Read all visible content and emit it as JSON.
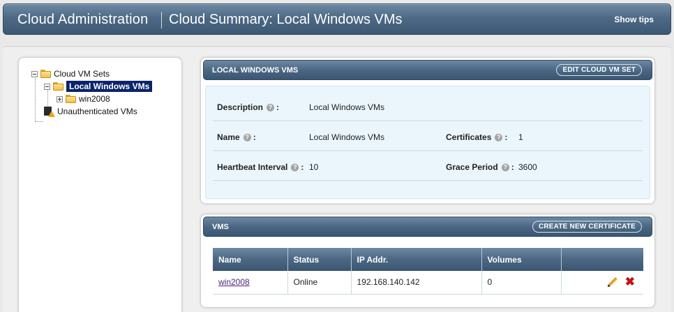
{
  "header": {
    "title": "Cloud Administration",
    "subtitle": "Cloud Summary: Local Windows VMs",
    "show_tips": "Show tips"
  },
  "tree": {
    "root": "Cloud VM Sets",
    "selected": "Local Windows VMs",
    "child": "win2008",
    "unauth": "Unauthenticated VMs"
  },
  "set_panel": {
    "title": "LOCAL WINDOWS VMS",
    "edit_button": "EDIT CLOUD VM SET",
    "description_label": "Description",
    "description_value": "Local Windows VMs",
    "name_label": "Name",
    "name_value": "Local Windows VMs",
    "certificates_label": "Certificates",
    "certificates_value": "1",
    "heartbeat_label": "Heartbeat Interval",
    "heartbeat_value": "10",
    "grace_label": "Grace Period",
    "grace_value": "3600",
    "help_glyph": "?"
  },
  "vms_panel": {
    "title": "VMS",
    "create_button": "CREATE NEW CERTIFICATE",
    "columns": [
      "Name",
      "Status",
      "IP Addr.",
      "Volumes",
      ""
    ],
    "rows": [
      {
        "name": "win2008",
        "status": "Online",
        "ip": "192.168.140.142",
        "volumes": "0"
      }
    ]
  },
  "colors": {
    "header_blue": "#4d6985",
    "panel_body": "#eaf6fc",
    "selection": "#0a246a",
    "delete_red": "#c01515"
  }
}
